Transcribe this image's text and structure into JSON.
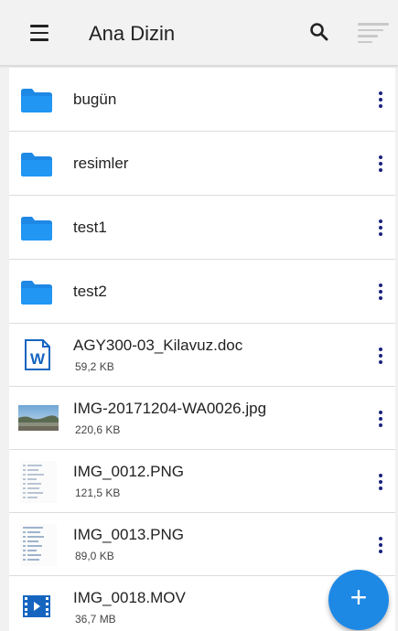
{
  "appbar": {
    "title": "Ana Dizin",
    "icons": [
      "menu-icon",
      "search-icon",
      "sort-icon"
    ]
  },
  "items": [
    {
      "type": "folder",
      "name": "bugün"
    },
    {
      "type": "folder",
      "name": "resimler"
    },
    {
      "type": "folder",
      "name": "test1"
    },
    {
      "type": "folder",
      "name": "test2"
    },
    {
      "type": "file",
      "kind": "word-document",
      "name": "AGY300-03_Kilavuz.doc",
      "size": "59,2 KB"
    },
    {
      "type": "file",
      "kind": "photo",
      "name": "IMG-20171204-WA0026.jpg",
      "size": "220,6 KB"
    },
    {
      "type": "file",
      "kind": "screenshot",
      "name": "IMG_0012.PNG",
      "size": "121,5 KB"
    },
    {
      "type": "file",
      "kind": "screenshot",
      "name": "IMG_0013.PNG",
      "size": "89,0 KB"
    },
    {
      "type": "file",
      "kind": "video",
      "name": "IMG_0018.MOV",
      "size": "36,7 MB"
    }
  ],
  "fab": {
    "label": "+",
    "icon": "plus-icon"
  },
  "colors": {
    "folder": "#1e88e5",
    "accent": "#1e88e5",
    "menu_dots": "#1a237e"
  }
}
